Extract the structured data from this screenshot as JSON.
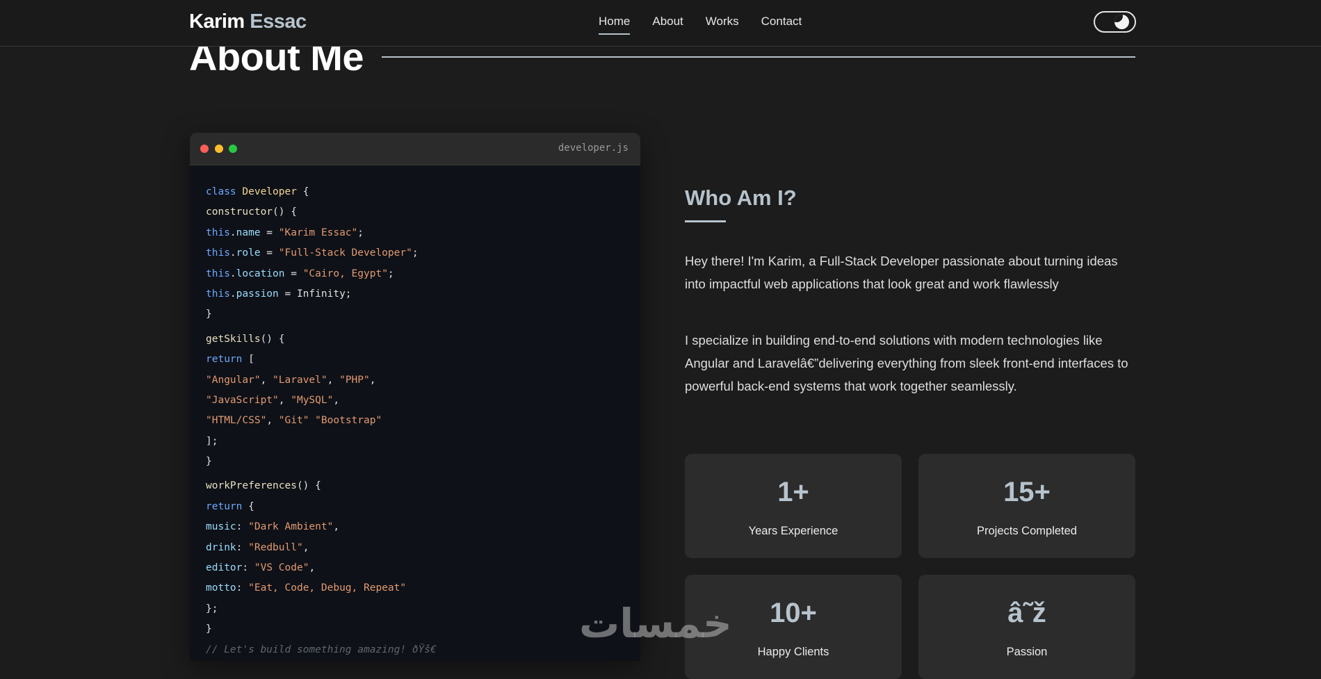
{
  "brand": {
    "first": "Karim",
    "last": "Essac"
  },
  "nav": {
    "items": [
      "Home",
      "About",
      "Works",
      "Contact"
    ],
    "active": "Home"
  },
  "theme_toggle": {
    "icon": "moon-icon"
  },
  "section": {
    "title": "About Me"
  },
  "code": {
    "filename": "developer.js",
    "lines": [
      [
        [
          "kw",
          "class"
        ],
        [
          "t",
          " "
        ],
        [
          "cls",
          "Developer"
        ],
        [
          "t",
          " {"
        ]
      ],
      [
        [
          "fn",
          "constructor"
        ],
        [
          "t",
          "() {"
        ]
      ],
      [
        [
          "kw",
          "this"
        ],
        [
          "t",
          "."
        ],
        [
          "prop",
          "name"
        ],
        [
          "t",
          " = "
        ],
        [
          "str",
          "\"Karim Essac\""
        ],
        [
          "t",
          ";"
        ]
      ],
      [
        [
          "kw",
          "this"
        ],
        [
          "t",
          "."
        ],
        [
          "prop",
          "role"
        ],
        [
          "t",
          " = "
        ],
        [
          "str",
          "\"Full-Stack Developer\""
        ],
        [
          "t",
          ";"
        ]
      ],
      [
        [
          "kw",
          "this"
        ],
        [
          "t",
          "."
        ],
        [
          "prop",
          "location"
        ],
        [
          "t",
          " = "
        ],
        [
          "str",
          "\"Cairo, Egypt\""
        ],
        [
          "t",
          ";"
        ]
      ],
      [
        [
          "kw",
          "this"
        ],
        [
          "t",
          "."
        ],
        [
          "prop",
          "passion"
        ],
        [
          "t",
          " = Infinity;"
        ]
      ],
      [
        [
          "t",
          "}"
        ]
      ],
      [
        [
          "fn",
          "getSkills"
        ],
        [
          "t",
          "() {"
        ]
      ],
      [
        [
          "kw",
          "return"
        ],
        [
          "t",
          " ["
        ]
      ],
      [
        [
          "str",
          "\"Angular\""
        ],
        [
          "t",
          ", "
        ],
        [
          "str",
          "\"Laravel\""
        ],
        [
          "t",
          ", "
        ],
        [
          "str",
          "\"PHP\""
        ],
        [
          "t",
          ","
        ]
      ],
      [
        [
          "str",
          "\"JavaScript\""
        ],
        [
          "t",
          ", "
        ],
        [
          "str",
          "\"MySQL\""
        ],
        [
          "t",
          ","
        ]
      ],
      [
        [
          "str",
          "\"HTML/CSS\""
        ],
        [
          "t",
          ", "
        ],
        [
          "str",
          "\"Git\""
        ],
        [
          "t",
          " "
        ],
        [
          "str",
          "\"Bootstrap\""
        ]
      ],
      [
        [
          "t",
          "];"
        ]
      ],
      [
        [
          "t",
          "}"
        ]
      ],
      [
        [
          "fn",
          "workPreferences"
        ],
        [
          "t",
          "() {"
        ]
      ],
      [
        [
          "kw",
          "return"
        ],
        [
          "t",
          " {"
        ]
      ],
      [
        [
          "prop",
          "music"
        ],
        [
          "t",
          ": "
        ],
        [
          "str",
          "\"Dark Ambient\""
        ],
        [
          "t",
          ","
        ]
      ],
      [
        [
          "prop",
          "drink"
        ],
        [
          "t",
          ": "
        ],
        [
          "str",
          "\"Redbull\""
        ],
        [
          "t",
          ","
        ]
      ],
      [
        [
          "prop",
          "editor"
        ],
        [
          "t",
          ": "
        ],
        [
          "str",
          "\"VS Code\""
        ],
        [
          "t",
          ","
        ]
      ],
      [
        [
          "prop",
          "motto"
        ],
        [
          "t",
          ": "
        ],
        [
          "str",
          "\"Eat, Code, Debug, Repeat\""
        ]
      ],
      [
        [
          "t",
          "};"
        ]
      ],
      [
        [
          "t",
          "}"
        ]
      ],
      [
        [
          "cmt",
          "// Let's build something amazing! ðŸš€"
        ]
      ]
    ],
    "group_start_lines": [
      7,
      14
    ]
  },
  "about": {
    "heading": "Who Am I?",
    "paragraphs": [
      "Hey there! I'm Karim, a Full-Stack Developer passionate about turning ideas into impactful web applications that look great and work flawlessly",
      "I specialize in building end-to-end solutions with modern technologies like Angular and Laravelâ€”delivering everything from sleek front-end interfaces to powerful back-end systems that work together seamlessly."
    ]
  },
  "stats": [
    {
      "value": "1+",
      "label": "Years Experience"
    },
    {
      "value": "15+",
      "label": "Projects Completed"
    },
    {
      "value": "10+",
      "label": "Happy Clients"
    },
    {
      "value": "â˜ž",
      "label": "Passion"
    }
  ],
  "watermark": "خمسات",
  "colors": {
    "background": "#1c1c1c",
    "accent": "#b7c3cc",
    "card": "#2c2c2c",
    "code_bg": "#0e1117"
  }
}
